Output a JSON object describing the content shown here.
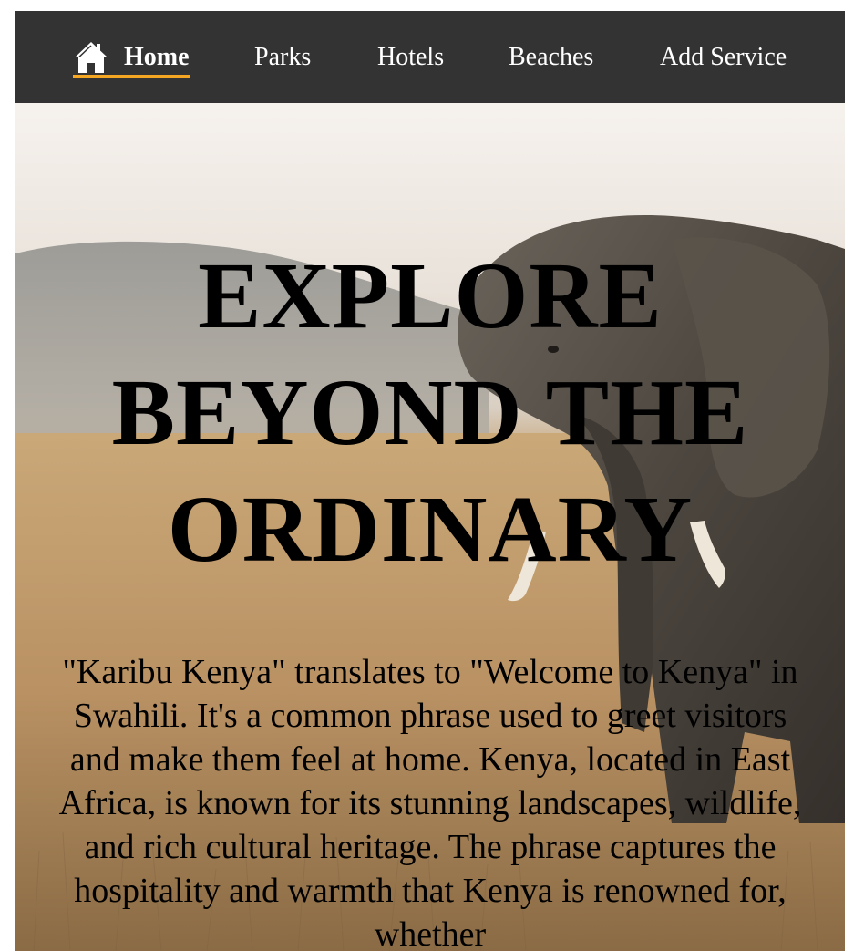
{
  "nav": {
    "home_label": "Home",
    "home_icon": "home-icon",
    "parks_label": "Parks",
    "hotels_label": "Hotels",
    "beaches_label": "Beaches",
    "add_service_label": "Add Service"
  },
  "colors": {
    "navbar_bg": "#333333",
    "nav_text": "#ffffff",
    "active_underline": "#f5a623"
  },
  "hero": {
    "title": "EXPLORE BEYOND THE ORDINARY",
    "description": "\"Karibu Kenya\" translates to \"Welcome to Kenya\" in Swahili. It's a common phrase used to greet visitors and make them feel at home. Kenya, located in East Africa, is known for its stunning landscapes, wildlife, and rich cultural heritage. The phrase captures the hospitality and warmth that Kenya is renowned for, whether"
  }
}
